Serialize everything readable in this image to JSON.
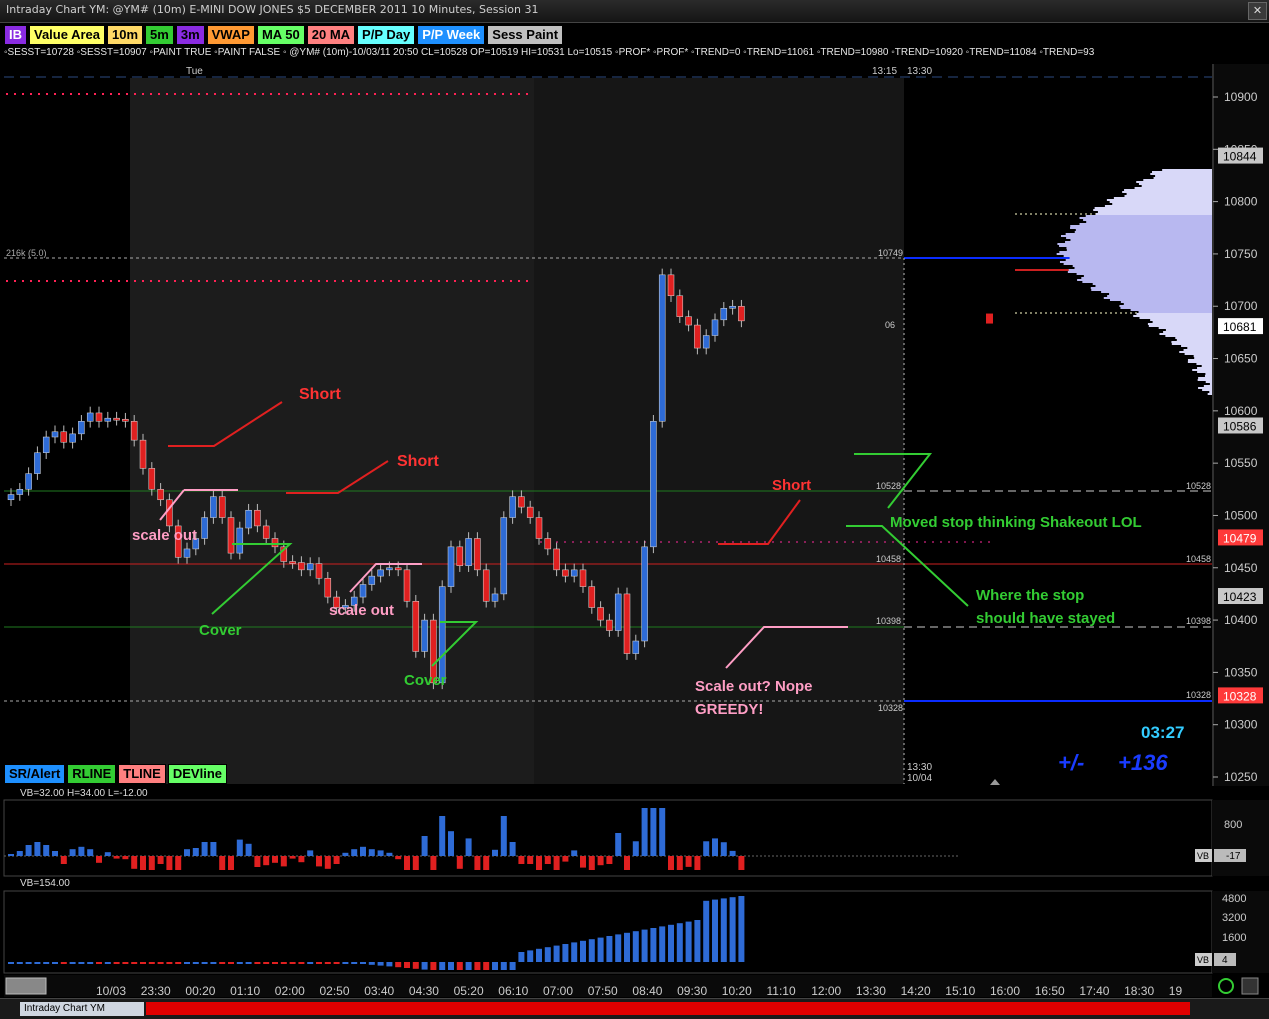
{
  "window": {
    "title": "Intraday Chart YM: @YM# (10m) E-MINI DOW JONES $5 DECEMBER 2011 10 Minutes, Session 31"
  },
  "toolbar": [
    {
      "label": "IB",
      "bg": "#8a2be2",
      "fg": "#ffffff"
    },
    {
      "label": "Value Area",
      "bg": "#ffff66",
      "fg": "#000000"
    },
    {
      "label": "10m",
      "bg": "#ffd966",
      "fg": "#000000"
    },
    {
      "label": "5m",
      "bg": "#33cc33",
      "fg": "#000000"
    },
    {
      "label": "3m",
      "bg": "#8a2be2",
      "fg": "#000000"
    },
    {
      "label": "VWAP",
      "bg": "#ff9933",
      "fg": "#000000"
    },
    {
      "label": "MA 50",
      "bg": "#66ff66",
      "fg": "#000000"
    },
    {
      "label": "20 MA",
      "bg": "#ff8080",
      "fg": "#000000"
    },
    {
      "label": "P/P Day",
      "bg": "#66ffff",
      "fg": "#000000"
    },
    {
      "label": "P/P Week",
      "bg": "#1e90ff",
      "fg": "#ffffff"
    },
    {
      "label": "Sess Paint",
      "bg": "#c0c0c0",
      "fg": "#000000"
    }
  ],
  "legend": "◦SESST=10728 ◦SESST=10907 ◦PAINT TRUE ◦PAINT FALSE ◦ @YM# (10m)-10/03/11 20:50 CL=10528 OP=10519 HI=10531 Lo=10515  ◦PROF* ◦PROF* ◦TREND=0 ◦TREND=11061 ◦TREND=10980 ◦TREND=10920 ◦TREND=11084 ◦TREND=93",
  "chart": {
    "top_labels": {
      "day": "Tue",
      "t1": "13:15",
      "t2": "13:30"
    },
    "scale_note": "216k (5.0)",
    "price_ticks": [
      "10900",
      "10850",
      "10800",
      "10750",
      "10700",
      "10650",
      "10600",
      "10550",
      "10500",
      "10450",
      "10400",
      "10350",
      "10300",
      "10250"
    ],
    "price_badges": [
      {
        "value": "10844",
        "style": "gray"
      },
      {
        "value": "10681",
        "style": "white"
      },
      {
        "value": "10586",
        "style": "gray"
      },
      {
        "value": "10479",
        "style": "red"
      },
      {
        "value": "10423",
        "style": "gray"
      },
      {
        "value": "10328",
        "style": "red"
      }
    ],
    "level_labels": [
      "10749",
      "10528",
      "10458",
      "10398",
      "10328",
      "10528",
      "10458",
      "10398",
      "10328",
      "06"
    ],
    "bottom_labels": {
      "time": "13:30",
      "date": "10/04"
    },
    "annotations": [
      {
        "text": "Short",
        "color": "#ff3333"
      },
      {
        "text": "Short",
        "color": "#ff3333"
      },
      {
        "text": "Short",
        "color": "#ff3333"
      },
      {
        "text": "scale out",
        "color": "#ff9ec5"
      },
      {
        "text": "scale out",
        "color": "#ff9ec5"
      },
      {
        "text": "Cover",
        "color": "#33cc33"
      },
      {
        "text": "Cover",
        "color": "#33cc33"
      },
      {
        "text": "Scale out? Nope",
        "color": "#ff9ec5"
      },
      {
        "text": "GREEDY!",
        "color": "#ff9ec5"
      },
      {
        "text": "Moved stop thinking Shakeout LOL",
        "color": "#33cc33"
      },
      {
        "text": "Where the stop",
        "color": "#33cc33"
      },
      {
        "text": "should have stayed",
        "color": "#33cc33"
      }
    ],
    "countdown": "03:27",
    "plusminus_label": "+/-",
    "plusminus_value": "+136"
  },
  "bottom_toolbar": [
    {
      "label": "SR/Alert",
      "bg": "#1e90ff",
      "fg": "#000000"
    },
    {
      "label": "RLINE",
      "bg": "#33cc33",
      "fg": "#000000"
    },
    {
      "label": "TLINE",
      "bg": "#ff8080",
      "fg": "#000000"
    },
    {
      "label": "DEVline",
      "bg": "#66ff66",
      "fg": "#000000"
    }
  ],
  "sub1": {
    "header": "VB=32.00 H=34.00 L=-12.00",
    "ticks": [
      "800",
      "0"
    ],
    "badge_label": "VB",
    "badge_value": "-17"
  },
  "sub2": {
    "header": "VB=154.00",
    "ticks": [
      "4800",
      "3200",
      "1600"
    ],
    "badge_label": "VB",
    "badge_value": "4"
  },
  "time_axis": [
    "10/03",
    "23:30",
    "00:20",
    "01:10",
    "02:00",
    "02:50",
    "03:40",
    "04:30",
    "05:20",
    "06:10",
    "07:00",
    "07:50",
    "08:40",
    "09:30",
    "10:20",
    "11:10",
    "12:00",
    "13:30",
    "14:20",
    "15:10",
    "16:00",
    "16:50",
    "17:40",
    "18:30",
    "19"
  ],
  "status": {
    "tab": "Intraday Chart YM"
  },
  "colors": {
    "up": "#2e6bd6",
    "down": "#e02020",
    "green_line": "#1f7a1f",
    "red_line": "#cc2020",
    "blue_line": "#0a2cff"
  },
  "chart_data": {
    "type": "candlestick",
    "closes": [
      10520,
      10525,
      10540,
      10560,
      10575,
      10580,
      10570,
      10578,
      10590,
      10598,
      10590,
      10593,
      10592,
      10590,
      10572,
      10545,
      10525,
      10515,
      10490,
      10460,
      10468,
      10478,
      10498,
      10518,
      10498,
      10464,
      10488,
      10505,
      10490,
      10478,
      10470,
      10456,
      10455,
      10448,
      10454,
      10440,
      10422,
      10412,
      10414,
      10422,
      10434,
      10442,
      10448,
      10450,
      10448,
      10418,
      10370,
      10400,
      10340,
      10432,
      10470,
      10452,
      10478,
      10448,
      10418,
      10425,
      10498,
      10518,
      10508,
      10498,
      10478,
      10468,
      10448,
      10442,
      10448,
      10432,
      10412,
      10400,
      10390,
      10425,
      10368,
      10380,
      10470,
      10590,
      10730,
      10710,
      10690,
      10682,
      10660,
      10672,
      10687,
      10698,
      10700,
      10686
    ],
    "ylim": [
      10240,
      10930
    ]
  }
}
